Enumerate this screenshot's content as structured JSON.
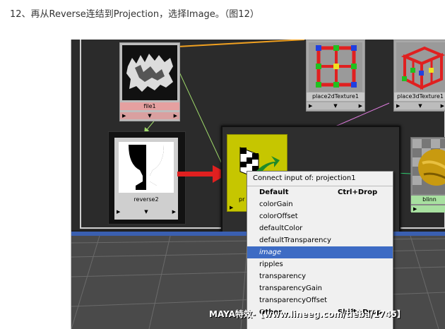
{
  "caption": "12、再从Reverse连结到Projection，选择Image。（图12）",
  "nodes": {
    "file": {
      "label": "file1"
    },
    "place2d": {
      "label": "place2dTexture1"
    },
    "place3d": {
      "label": "place3dTexture1"
    },
    "reverse": {
      "label": "reverse2"
    },
    "projection": {
      "label": "pr"
    },
    "blinn": {
      "label": "blinn"
    }
  },
  "context_menu": {
    "header": "Connect input of: projection1",
    "items": [
      {
        "label": "Default",
        "shortcut": "Ctrl+Drop",
        "bold": true
      },
      {
        "label": "colorGain"
      },
      {
        "label": "colorOffset"
      },
      {
        "label": "defaultColor"
      },
      {
        "label": "defaultTransparency"
      },
      {
        "label": "image",
        "selected": true
      },
      {
        "label": "ripples"
      },
      {
        "label": "transparency"
      },
      {
        "label": "transparencyGain"
      },
      {
        "label": "transparencyOffset"
      },
      {
        "label": "Other...",
        "shortcut": "Shift+Drop",
        "bold": true
      }
    ]
  },
  "watermark": "MAYA特效-【www.lineeg.com/tieba/1745】",
  "colors": {
    "selected_bg": "#3d6bc4",
    "file_label_bg": "#e5a0a0",
    "place_label_bg": "#c8c8c8",
    "projection_bg": "#c6c600",
    "blinn_label_bg": "#a8e0a0",
    "arrow_red": "#e02020"
  }
}
